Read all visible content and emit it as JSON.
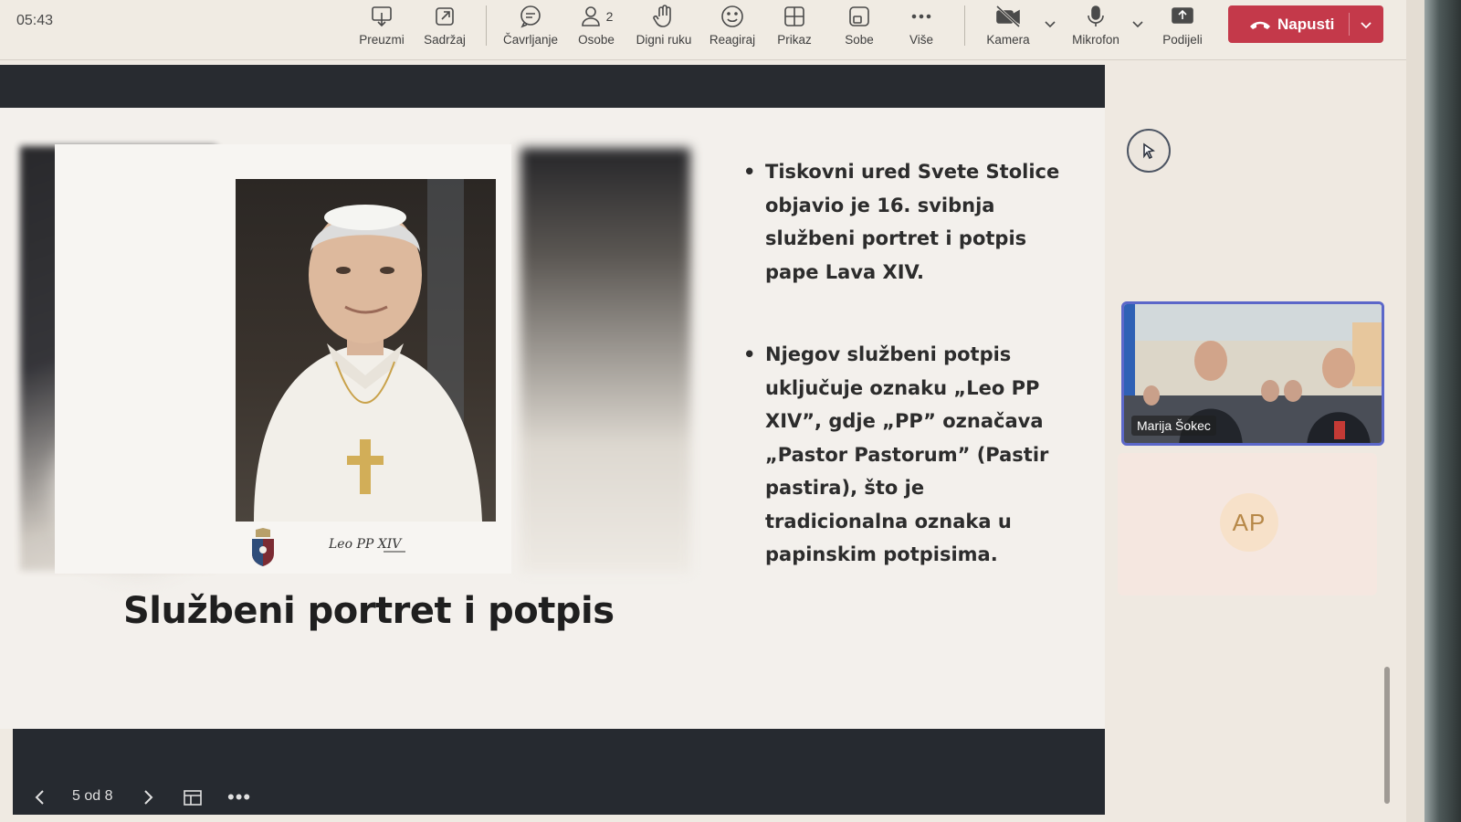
{
  "clock": "05:43",
  "toolbar": {
    "download": "Preuzmi",
    "content": "Sadržaj",
    "chat": "Čavrljanje",
    "people": "Osobe",
    "people_count": "2",
    "raise_hand": "Digni ruku",
    "react": "Reagiraj",
    "view": "Prikaz",
    "rooms": "Sobe",
    "more": "Više",
    "camera": "Kamera",
    "microphone": "Mikrofon",
    "share": "Podijeli",
    "leave": "Napusti"
  },
  "slide": {
    "title": "Službeni portret i potpis",
    "signature_text": "Leo PP XIV",
    "bullets": [
      "Tiskovni ured Svete Stolice objavio je 16. svibnja službeni portret i potpis pape Lava XIV.",
      "Njegov službeni potpis uključuje oznaku „Leo PP XIV”, gdje „PP” označava „Pastor Pastorum” (Pastir pastira), što je tradicionalna oznaka u papinskim potpisima."
    ],
    "counter": "5 od 8"
  },
  "participants": {
    "video_name": "Marija Šokec",
    "avatar_initials": "AP"
  },
  "colors": {
    "leave_button": "#c4394a",
    "active_speaker_border": "#5b67c9",
    "slide_bar": "#262a30"
  }
}
